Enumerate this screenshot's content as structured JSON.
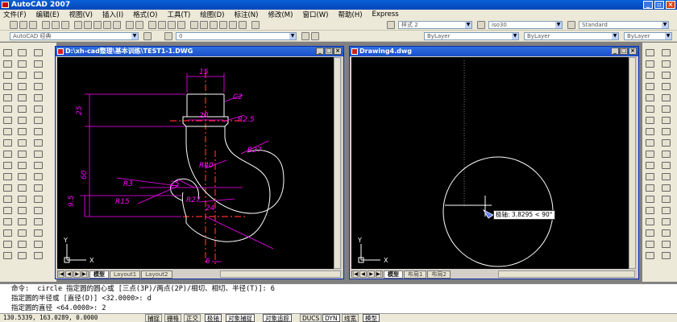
{
  "app": {
    "title": "AutoCAD 2007"
  },
  "menu": [
    "文件(F)",
    "编辑(E)",
    "视图(V)",
    "插入(I)",
    "格式(O)",
    "工具(T)",
    "绘图(D)",
    "标注(N)",
    "修改(M)",
    "窗口(W)",
    "帮助(H)",
    "Express"
  ],
  "toolbars": {
    "text_style": "样式 2",
    "dim_style": "iso30",
    "table_style": "Standard",
    "workspace": "AutoCAD 经典",
    "layer": "0",
    "color": "ByLayer",
    "linetype": "ByLayer",
    "lineweight": "ByLayer",
    "plot_style": "ByColor"
  },
  "windows": [
    {
      "title": "D:\\xh-cad整理\\基本训练\\TEST1-1.DWG",
      "tabs": [
        "模型",
        "Layout1",
        "Layout2"
      ],
      "active_tab": "模型",
      "dims": {
        "d15": "15",
        "c2": "C2",
        "d20": "20",
        "r25": "R2.5",
        "d25": "25",
        "r40": "R40",
        "r27a": "R27",
        "d60": "60",
        "r27b": "R27",
        "r15": "R15",
        "r3": "R3",
        "d95": "9.5",
        "d24": "24",
        "d6": "6"
      },
      "ucs": {
        "x": "X",
        "y": "Y"
      }
    },
    {
      "title": "Drawing4.dwg",
      "tabs": [
        "模型",
        "布局1",
        "布局2"
      ],
      "active_tab": "模型",
      "tooltip": "极轴: 3.8295 < 90°",
      "ucs": {
        "x": "X",
        "y": "Y"
      }
    }
  ],
  "command_history": [
    "命令:  circle 指定圆的圆心或 [三点(3P)/两点(2P)/相切、相切、半径(T)]: 6",
    "指定圆的半径或 [直径(D)] <32.0000>: d",
    "指定圆的直径 <64.0000>: 2"
  ],
  "status": {
    "coordinates": "130.5339, 163.0289, 0.0000",
    "buttons": [
      {
        "label": "捕捉",
        "on": false
      },
      {
        "label": "栅格",
        "on": false
      },
      {
        "label": "正交",
        "on": false
      },
      {
        "label": "极轴",
        "on": true
      },
      {
        "label": "对象捕捉",
        "on": true
      },
      {
        "label": "对象追踪",
        "on": true
      },
      {
        "label": "DUCS",
        "on": false
      },
      {
        "label": "DYN",
        "on": true
      },
      {
        "label": "线宽",
        "on": false
      },
      {
        "label": "模型",
        "on": true
      }
    ]
  },
  "colors": {
    "titlebar": "#0a5fd8",
    "drawing_geometry": "#ffffff",
    "dimension_magenta": "#ff00ff",
    "centerline_red": "#ff2a2a",
    "canvas": "#000000",
    "cursor_blue": "#6080ff"
  }
}
